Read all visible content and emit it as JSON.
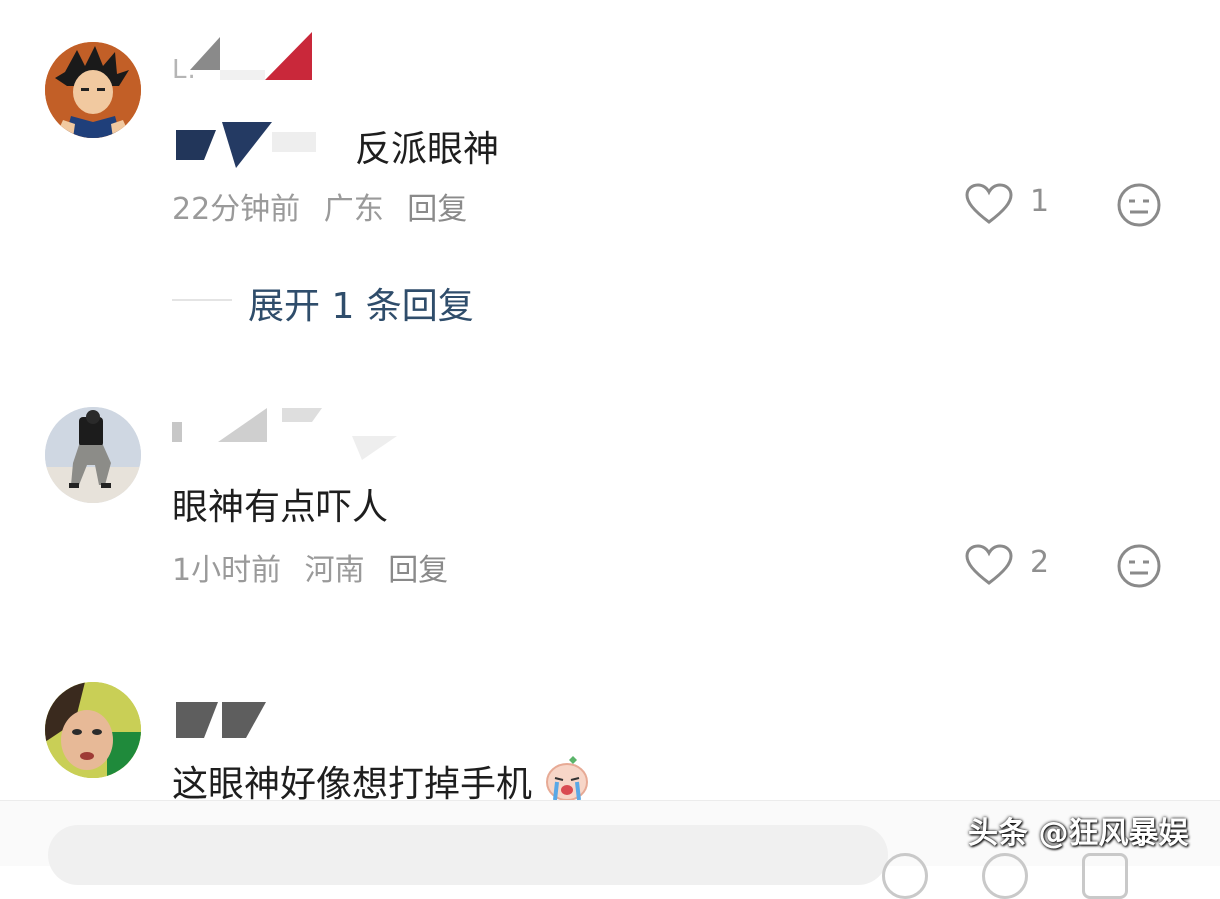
{
  "comments": [
    {
      "username": "L.",
      "text": "反派眼神",
      "time": "22分钟前",
      "location": "广东",
      "reply_label": "回复",
      "likes": "1",
      "avatar_icon": "cartoon-avatar-icon"
    },
    {
      "username": "",
      "text": "眼神有点吓人",
      "time": "1小时前",
      "location": "河南",
      "reply_label": "回复",
      "likes": "2",
      "avatar_icon": "person-avatar-icon"
    },
    {
      "username": "",
      "text": "这眼神好像想打掉手机",
      "avatar_icon": "selfie-avatar-icon"
    }
  ],
  "expand_replies_label": "展开 1 条回复",
  "watermark": "头条 @狂风暴娱",
  "colors": {
    "link": "#2f4d6b",
    "meta": "#9a9a9a",
    "text": "#1e1e1e"
  }
}
